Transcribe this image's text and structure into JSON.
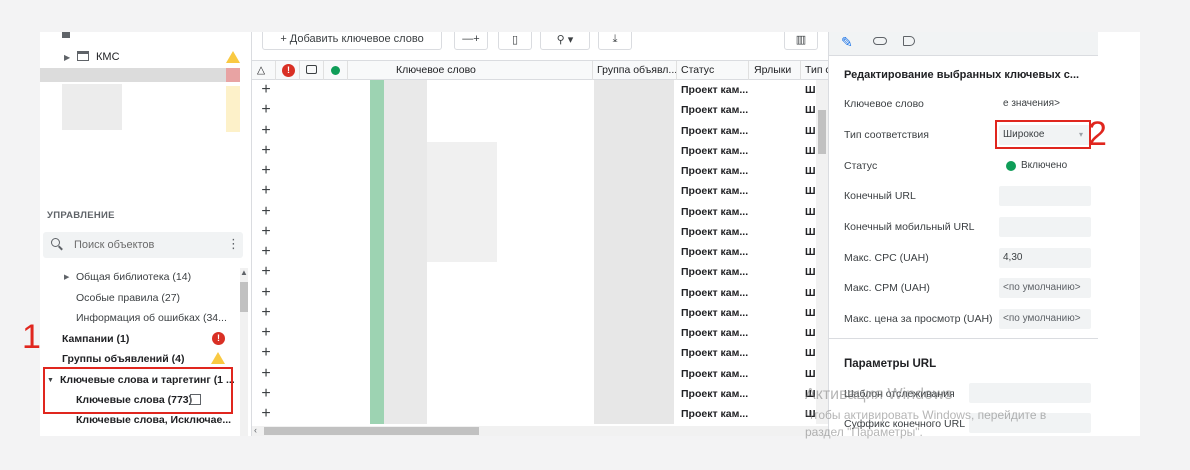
{
  "tree": {
    "kms_label": "КМС"
  },
  "manage": {
    "title": "УПРАВЛЕНИЕ",
    "search_placeholder": "Поиск объектов",
    "items": [
      {
        "label": "Общая библиотека (14)"
      },
      {
        "label": "Особые правила (27)"
      },
      {
        "label": "Информация об ошибках (34..."
      },
      {
        "label": "Кампании (1)"
      },
      {
        "label": "Группы объявлений (4)"
      },
      {
        "label": "Ключевые слова и таргетинг (1 ..."
      },
      {
        "label": "Ключевые слова (773)"
      },
      {
        "label": "Ключевые слова, Исключае..."
      }
    ]
  },
  "toolbar": {
    "add_keyword_label": "+ Добавить ключевое слово"
  },
  "grid": {
    "columns": {
      "keyword": "Ключевое слово",
      "ad_group": "Группа объявл...",
      "status": "Статус",
      "labels": "Ярлыки",
      "match_type": "Тип соо..."
    },
    "row_status": "Проект кам...",
    "row_match": "Широк...",
    "row_count": 17
  },
  "panel": {
    "section_title": "Редактирование выбранных ключевых с...",
    "fields": {
      "keyword_label": "Ключевое слово",
      "keyword_value": "е значения>",
      "match_label": "Тип соответствия",
      "match_value": "Широкое",
      "status_label": "Статус",
      "status_value": "Включено",
      "final_url_label": "Конечный URL",
      "mobile_url_label": "Конечный мобильный URL",
      "max_cpc_label": "Макс. CPC (UAH)",
      "max_cpc_value": "4,30",
      "max_cpm_label": "Макс. CPM (UAH)",
      "max_cpm_value": "<по умолчанию>",
      "max_view_label": "Макс. цена за просмотр (UAH)",
      "max_view_value": "<по умолчанию>"
    },
    "url_section_title": "Параметры URL",
    "tracking_label": "Шаблон отслеживания",
    "suffix_label": "Суффикс конечного URL"
  },
  "annotations": {
    "one": "1",
    "two": "2"
  },
  "watermark": {
    "line1": "Активация Windows",
    "line2": "Чтобы активировать Windows, перейдите в",
    "line3": "раздел \"Параметры\"."
  },
  "colors": {
    "annotation_red": "#e0261e",
    "status_green": "#0f9d58",
    "error_red": "#d93025",
    "warning_yellow": "#f9c942"
  }
}
